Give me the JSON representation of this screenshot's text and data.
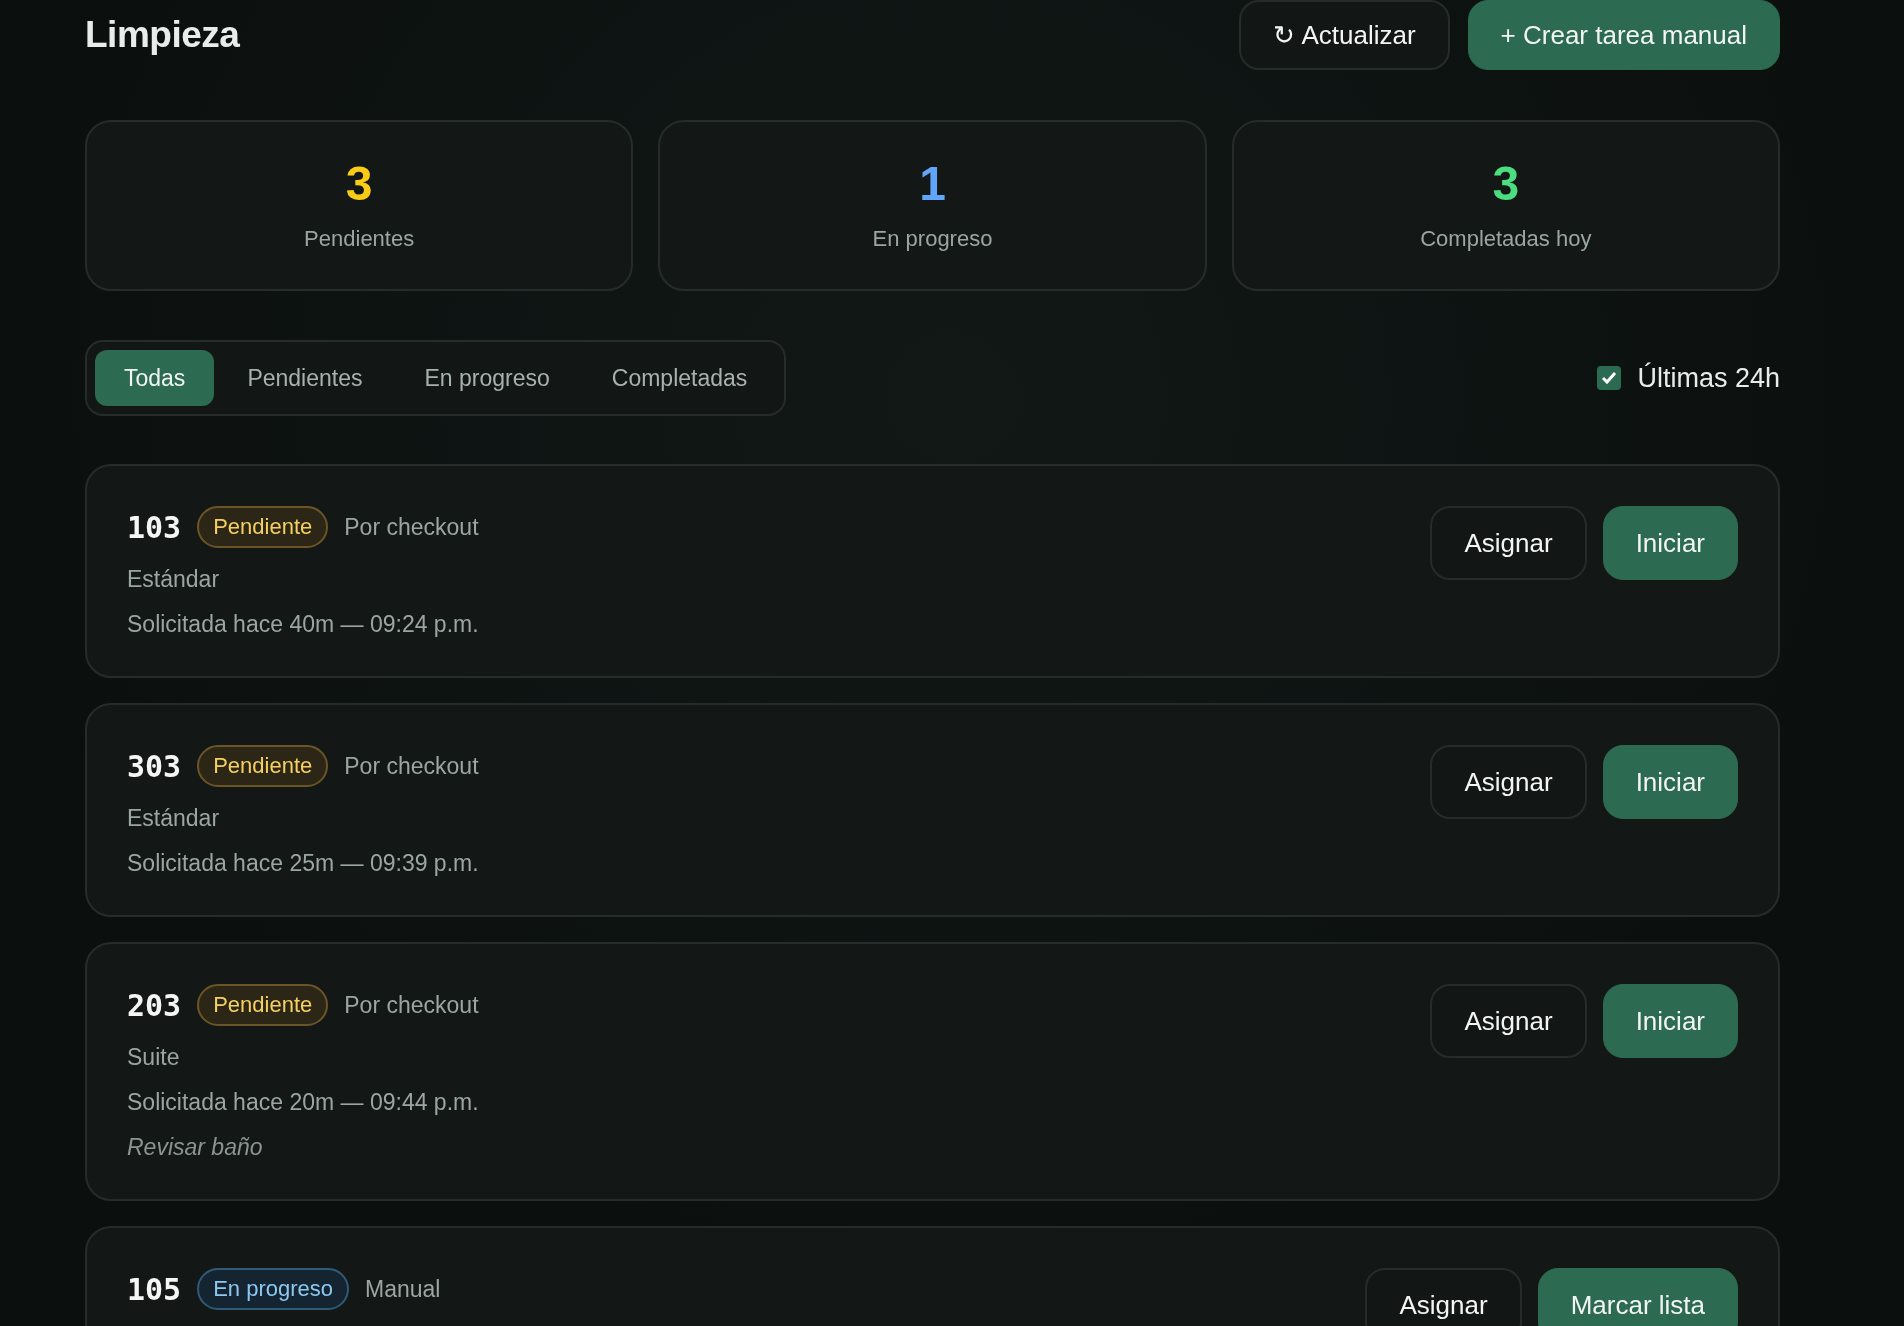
{
  "header": {
    "title": "Limpieza",
    "buttons": [
      {
        "label": "Actualizar",
        "icon": "↻",
        "kind": "outline"
      },
      {
        "label": "+ Crear tarea manual",
        "kind": "primary"
      }
    ]
  },
  "stats": [
    {
      "value": "3",
      "label": "Pendientes",
      "color": "#facc15"
    },
    {
      "value": "1",
      "label": "En progreso",
      "color": "#60a5fa"
    },
    {
      "value": "3",
      "label": "Completadas hoy",
      "color": "#4ade80"
    }
  ],
  "filters": {
    "tabs": [
      {
        "label": "Todas",
        "selected": true
      },
      {
        "label": "Pendientes",
        "selected": false
      },
      {
        "label": "En progreso",
        "selected": false
      },
      {
        "label": "Completadas",
        "selected": false
      }
    ],
    "last_24h": {
      "label": "Últimas 24h",
      "checked": true
    }
  },
  "tasks": [
    {
      "room": "103",
      "status": {
        "label": "Pendiente",
        "kind": "pending"
      },
      "origin": "Por checkout",
      "type": "Estándar",
      "requested": "Solicitada hace 40m — 09:24 p.m.",
      "actions": [
        {
          "label": "Asignar",
          "kind": "outline"
        },
        {
          "label": "Iniciar",
          "kind": "primary"
        }
      ]
    },
    {
      "room": "303",
      "status": {
        "label": "Pendiente",
        "kind": "pending"
      },
      "origin": "Por checkout",
      "type": "Estándar",
      "requested": "Solicitada hace 25m — 09:39 p.m.",
      "actions": [
        {
          "label": "Asignar",
          "kind": "outline"
        },
        {
          "label": "Iniciar",
          "kind": "primary"
        }
      ]
    },
    {
      "room": "203",
      "status": {
        "label": "Pendiente",
        "kind": "pending"
      },
      "origin": "Por checkout",
      "type": "Suite",
      "requested": "Solicitada hace 20m — 09:44 p.m.",
      "note": "Revisar baño",
      "actions": [
        {
          "label": "Asignar",
          "kind": "outline"
        },
        {
          "label": "Iniciar",
          "kind": "primary"
        }
      ]
    },
    {
      "room": "105",
      "status": {
        "label": "En progreso",
        "kind": "in_progress"
      },
      "origin": "Manual",
      "actions": [
        {
          "label": "Asignar",
          "kind": "outline"
        },
        {
          "label": "Marcar lista",
          "kind": "primary"
        }
      ]
    }
  ]
}
